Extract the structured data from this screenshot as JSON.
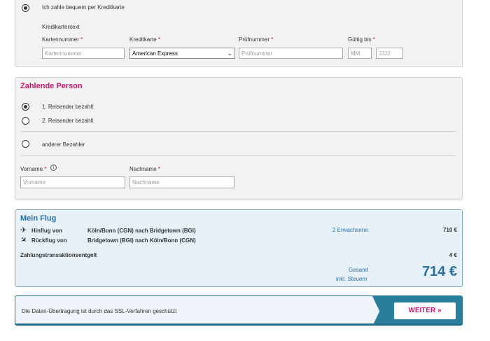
{
  "credit_card": {
    "option_label": "Ich zahle bequem per Kreditkarte",
    "section_label": "Kredikartentext",
    "fields": {
      "card_number": {
        "label": "Kartennummer",
        "required": "*",
        "placeholder": "Kartennummer"
      },
      "card_type": {
        "label": "Kreditkarte",
        "required": "*",
        "value": "American Express"
      },
      "cvc": {
        "label": "Prüfnummer",
        "required": "*",
        "placeholder": "Prüfnummer"
      },
      "valid_until": {
        "label": "Gültig bis",
        "required": "*",
        "month_placeholder": "MM",
        "year_placeholder": "JJJJ"
      }
    }
  },
  "paying_person": {
    "title": "Zahlende Person",
    "options": [
      {
        "label": "1. Reisender bezahlt",
        "checked": true
      },
      {
        "label": "2. Reisender bezahlt",
        "checked": false
      },
      {
        "label": "anderer Bezahler",
        "checked": false
      }
    ],
    "first_name": {
      "label": "Vorname",
      "required": "*",
      "placeholder": "Vorname",
      "info_icon": "i"
    },
    "last_name": {
      "label": "Nachname",
      "required": "*",
      "placeholder": "Nachname"
    }
  },
  "flight": {
    "title": "Mein Flug",
    "outbound": {
      "label": "Hinflug von",
      "route": "Köln/Bonn (CGN) nach Bridgetown (BGI)",
      "icon": "plane-departure-icon"
    },
    "return": {
      "label": "Rückflug von",
      "route": "Bridgetown (BGI) nach Köln/Bonn (CGN)",
      "icon": "plane-arrival-icon"
    },
    "passengers": "2 Erwachsene",
    "flight_price": "710 €",
    "fee_label": "Zahlungstransaktionsentgelt",
    "fee_price": "4 €",
    "total_label": "Gesamt",
    "total_sublabel": "inkl. Steuern",
    "total_price": "714 €"
  },
  "footer": {
    "ssl_text": "Die Daten-Übertragung ist durch das SSL-Verfahren geschützt",
    "next_button": "WEITER »"
  },
  "colors": {
    "accent_magenta": "#c8186e",
    "accent_blue": "#2a6fa0",
    "footer_teal": "#2b7d9c"
  }
}
